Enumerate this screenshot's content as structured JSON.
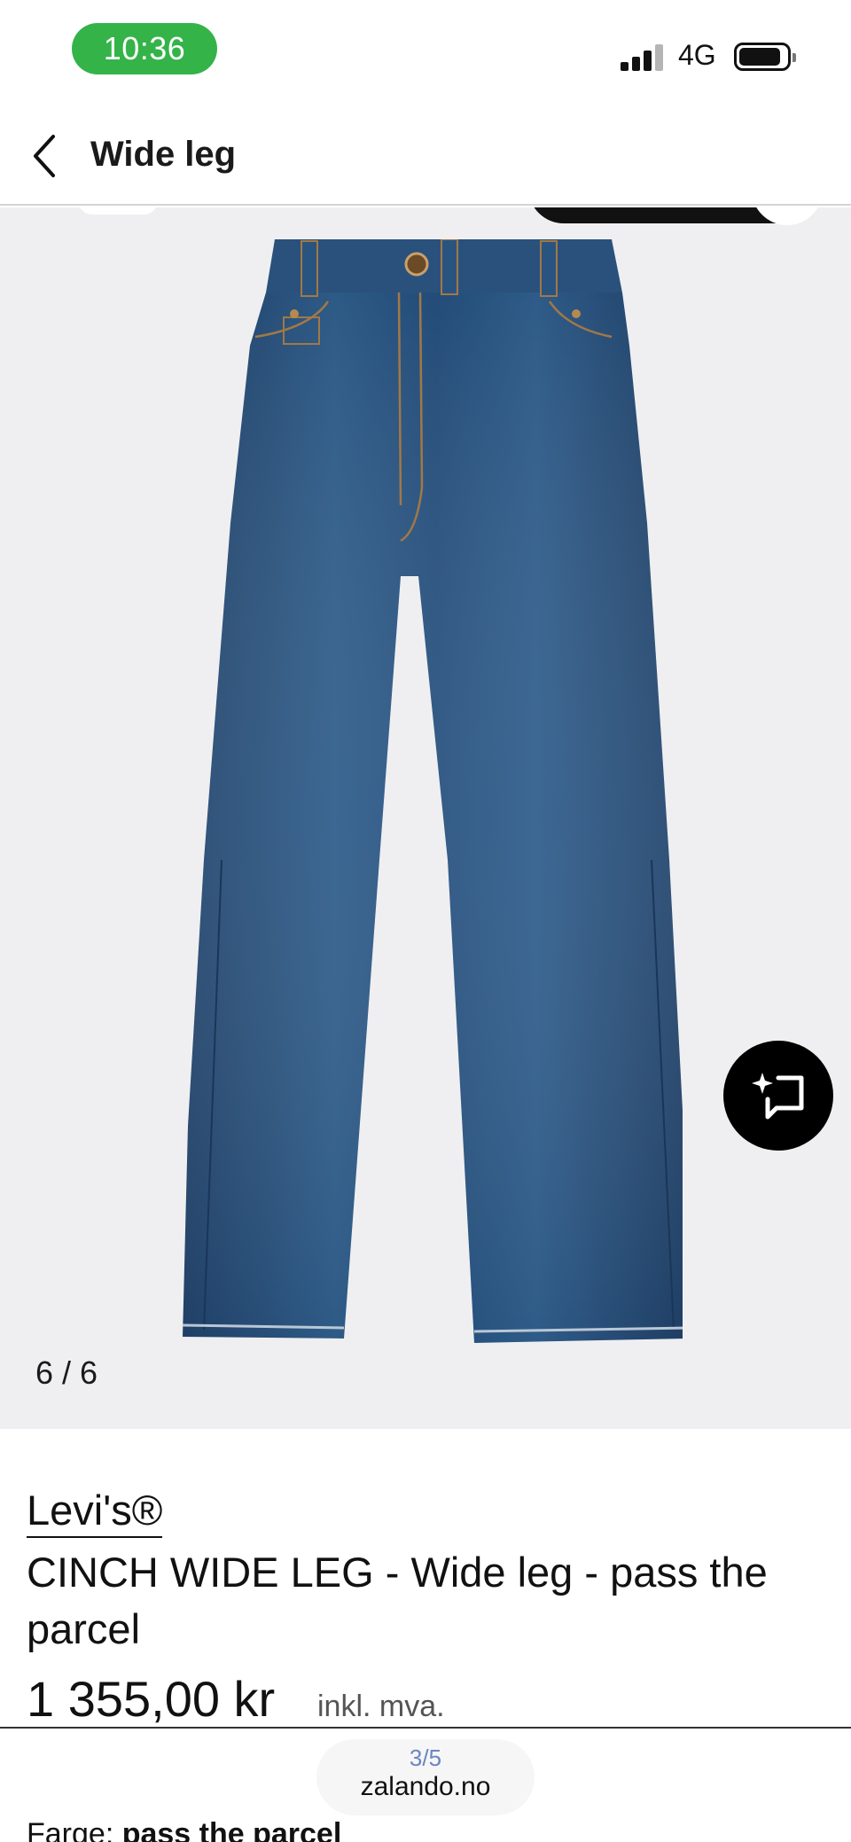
{
  "status_bar": {
    "time": "10:36",
    "network": "4G",
    "signal_bars_filled": 3,
    "signal_bars_total": 4,
    "time_pill_color": "#34b349"
  },
  "nav": {
    "title": "Wide leg",
    "back_icon": "chevron-left-icon"
  },
  "gallery": {
    "counter": "6 / 6",
    "similar_icon": "sparkle-crop-icon",
    "background": "#efeff1"
  },
  "product": {
    "brand": "Levi's®",
    "name": "CINCH WIDE LEG - Wide leg - pass the parcel",
    "price": "1 355,00 kr",
    "vat_label": "inkl. mva.",
    "color_label": "Farge:",
    "color_value": "pass the parcel"
  },
  "browser": {
    "page_indicator": "3/5",
    "url": "zalando.no"
  }
}
